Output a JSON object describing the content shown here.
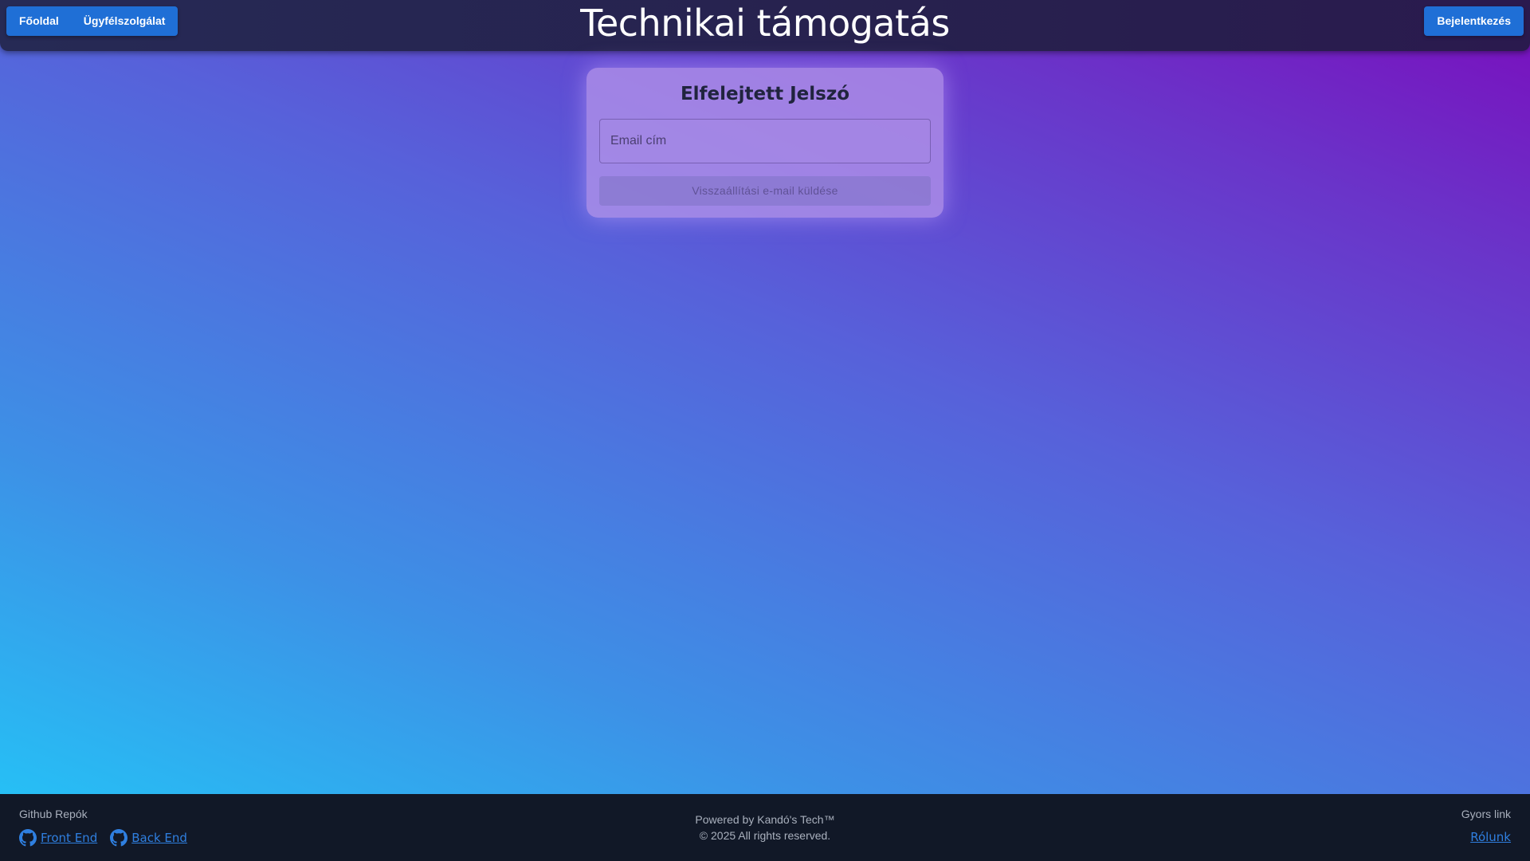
{
  "header": {
    "title": "Technikai támogatás",
    "nav": [
      {
        "label": "Főoldal"
      },
      {
        "label": "Ügyfélszolgálat"
      }
    ],
    "login_label": "Bejelentkezés"
  },
  "card": {
    "title": "Elfelejtett Jelszó",
    "email_placeholder": "Email cím",
    "email_value": "",
    "submit_label": "Visszaállítási e-mail küldése"
  },
  "footer": {
    "left_heading": "Github Repók",
    "links": [
      {
        "label": "Front End",
        "icon": "github-icon"
      },
      {
        "label": "Back End",
        "icon": "github-icon"
      }
    ],
    "powered_by": "Powered by Kandó's Tech™",
    "copyright": "© 2025 All rights reserved.",
    "right_heading": "Gyors link",
    "right_link": "Rólunk"
  },
  "colors": {
    "accent": "#1f6fd6",
    "header_bg": "#262a55",
    "footer_bg": "#111827",
    "link": "#2f7fe0",
    "gradient_start": "#22c8f8",
    "gradient_end": "#7a0dbd"
  }
}
